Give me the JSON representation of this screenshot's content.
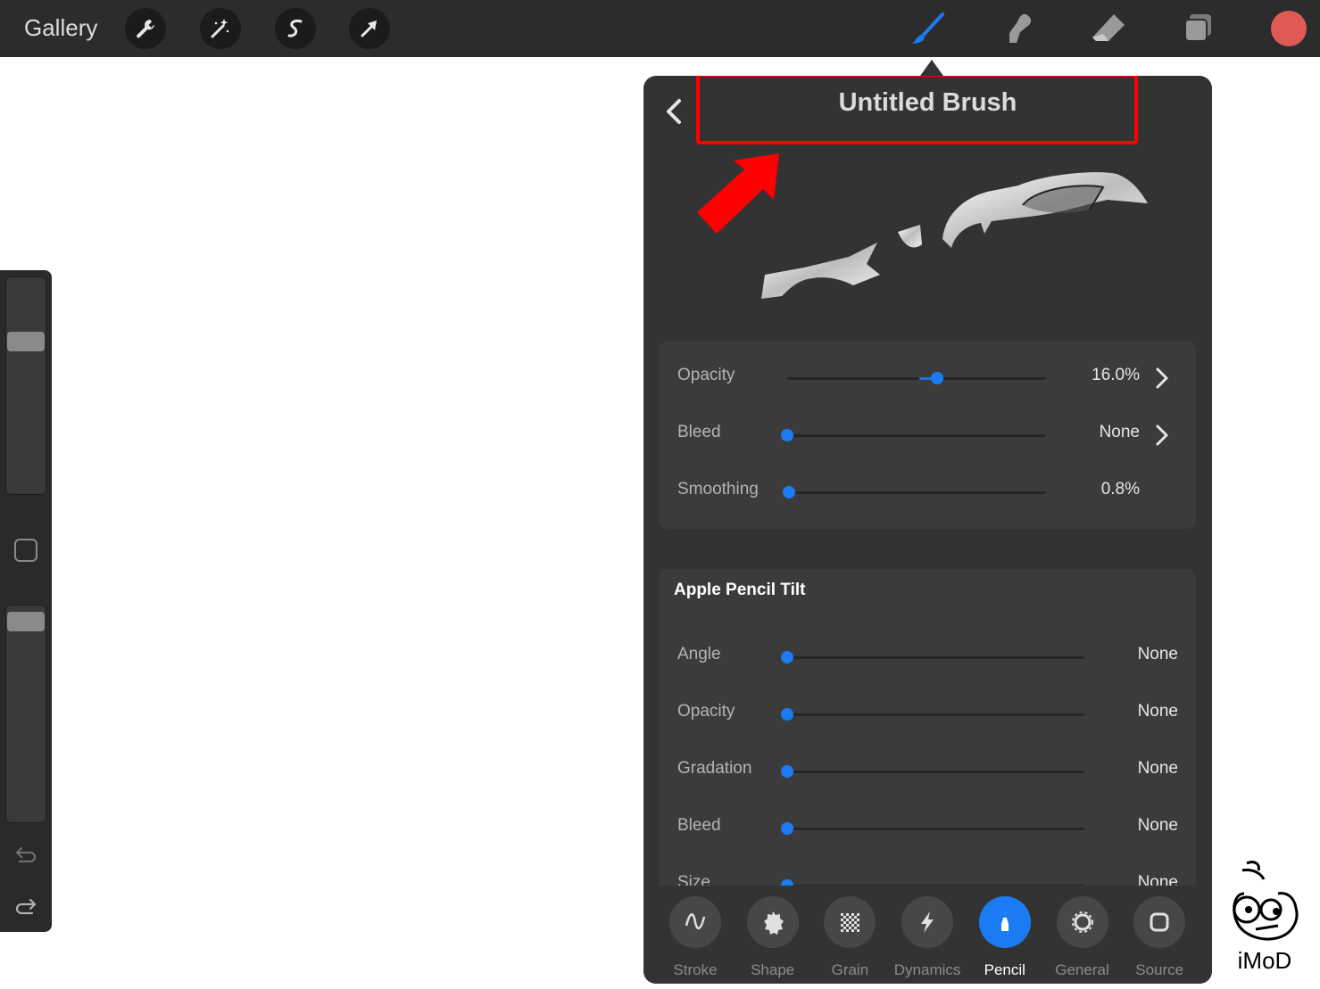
{
  "topbar": {
    "gallery_label": "Gallery",
    "left_tools": [
      "wrench-icon",
      "magic-wand-icon",
      "selection-icon",
      "transform-arrow-icon"
    ],
    "right_tools": [
      "brush-icon",
      "smudge-icon",
      "eraser-icon",
      "layers-icon"
    ],
    "current_color": "#e05a55",
    "active_tool_color": "#1a7bf2"
  },
  "sidebar": {
    "brush_size_level": 0.72,
    "brush_opacity_level": 0.97
  },
  "panel": {
    "title": "Untitled Brush",
    "general_rows": [
      {
        "label": "Opacity",
        "value": "16.0%",
        "level": 0.58,
        "has_chevron": true
      },
      {
        "label": "Bleed",
        "value": "None",
        "level": 0.0,
        "has_chevron": true
      },
      {
        "label": "Smoothing",
        "value": "0.8%",
        "level": 0.008,
        "has_chevron": false
      }
    ],
    "tilt_section": {
      "header": "Apple Pencil Tilt",
      "rows": [
        {
          "label": "Angle",
          "value": "None",
          "level": 0.0
        },
        {
          "label": "Opacity",
          "value": "None",
          "level": 0.0
        },
        {
          "label": "Gradation",
          "value": "None",
          "level": 0.0
        },
        {
          "label": "Bleed",
          "value": "None",
          "level": 0.0
        },
        {
          "label": "Size",
          "value": "None",
          "level": 0.0
        }
      ]
    },
    "tabs": [
      {
        "label": "Stroke",
        "icon": "stroke-icon",
        "active": false
      },
      {
        "label": "Shape",
        "icon": "shape-icon",
        "active": false
      },
      {
        "label": "Grain",
        "icon": "grain-icon",
        "active": false
      },
      {
        "label": "Dynamics",
        "icon": "dynamics-icon",
        "active": false
      },
      {
        "label": "Pencil",
        "icon": "pencil-icon",
        "active": true
      },
      {
        "label": "General",
        "icon": "general-icon",
        "active": false
      },
      {
        "label": "Source",
        "icon": "source-icon",
        "active": false
      }
    ]
  },
  "watermark": {
    "text": "iMoD"
  }
}
